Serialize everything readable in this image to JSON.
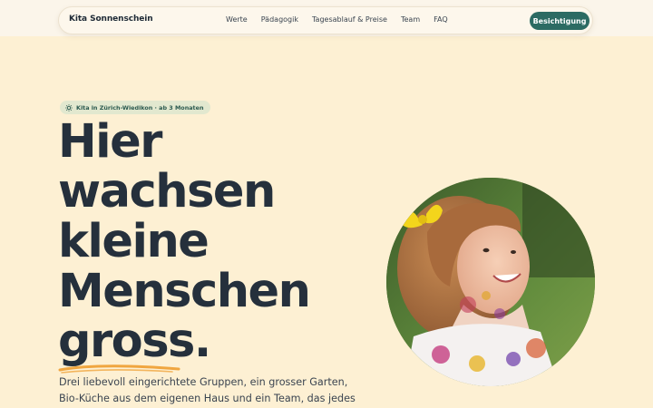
{
  "header": {
    "brand": "Kita Sonnenschein",
    "nav": [
      "Werte",
      "Pädagogik",
      "Tagesablauf & Preise",
      "Team",
      "FAQ"
    ],
    "cta_label": "Besichtigung"
  },
  "hero": {
    "badge": "Kita in Zürich-Wiedikon · ab 3 Monaten",
    "headline_lines": [
      "Hier",
      "wachsen",
      "kleine",
      "Menschen"
    ],
    "headline_emphasis": "gross",
    "headline_punct": ".",
    "lead": "Drei liebevoll eingerichtete Gruppen, ein grosser Garten, Bio-Küche aus dem eigenen Haus und ein Team, das jedes"
  },
  "colors": {
    "page_bg": "#fdf0d3",
    "accent_green": "#2c6b63",
    "badge_bg": "#e2e8cf",
    "underline": "#f0a640",
    "text_dark": "#25303c"
  },
  "icons": {
    "badge_icon": "sun-icon"
  }
}
